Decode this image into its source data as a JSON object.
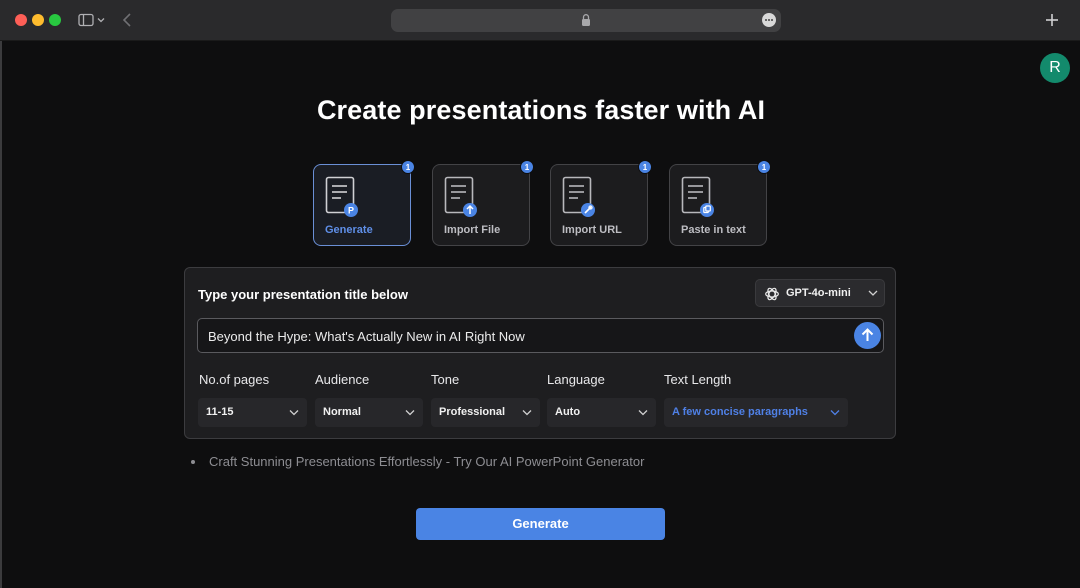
{
  "browser": {
    "colors": {
      "red": "#fe5f57",
      "yellow": "#febc2e",
      "green": "#28c840"
    }
  },
  "user": {
    "avatar_initial": "R",
    "avatar_color": "#138a6c"
  },
  "main": {
    "title": "Create presentations faster with AI",
    "modes": [
      {
        "label": "Generate",
        "badge": "1",
        "icon": "generate-icon",
        "active": true
      },
      {
        "label": "Import File",
        "badge": "1",
        "icon": "upload-icon",
        "active": false
      },
      {
        "label": "Import URL",
        "badge": "1",
        "icon": "link-icon",
        "active": false
      },
      {
        "label": "Paste in text",
        "badge": "1",
        "icon": "paste-icon",
        "active": false
      }
    ],
    "panel": {
      "heading": "Type your presentation title below",
      "model": "GPT-4o-mini",
      "prompt_value": "Beyond the Hype: What's Actually New in AI Right Now",
      "options": [
        {
          "label": "No.of pages",
          "value": "11-15"
        },
        {
          "label": "Audience",
          "value": "Normal"
        },
        {
          "label": "Tone",
          "value": "Professional"
        },
        {
          "label": "Language",
          "value": "Auto"
        },
        {
          "label": "Text Length",
          "value": "A few concise paragraphs"
        }
      ]
    },
    "tip": "Craft Stunning Presentations Effortlessly - Try Our AI PowerPoint Generator",
    "generate_button": "Generate",
    "accent_color": "#4a84e4"
  }
}
